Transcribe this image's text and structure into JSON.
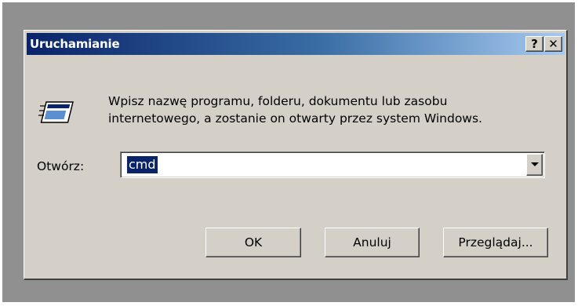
{
  "dialog": {
    "title": "Uruchamianie",
    "help_label": "?",
    "close_label": "✕",
    "description_line1": "Wpisz nazwę programu, folderu, dokumentu lub zasobu",
    "description_line2": "internetowego, a zostanie on otwarty przez system Windows.",
    "open_label": "Otwórz:",
    "open_value": "cmd",
    "buttons": {
      "ok": "OK",
      "cancel": "Anuluj",
      "browse": "Przeglądaj..."
    },
    "icon": "run-icon"
  },
  "colors": {
    "title_gradient_start": "#0a246a",
    "title_gradient_end": "#a6caf0",
    "dialog_face": "#d4d0c8",
    "selection": "#0a246a"
  }
}
